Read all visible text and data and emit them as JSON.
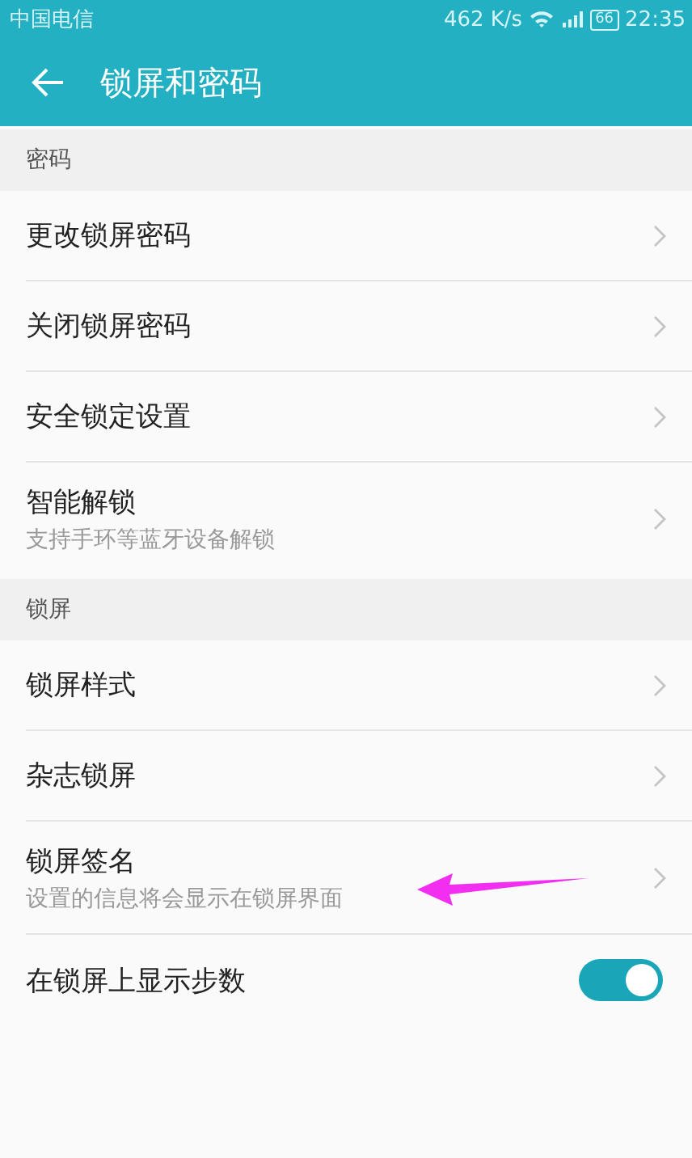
{
  "status_bar": {
    "carrier": "中国电信",
    "speed": "462 K/s",
    "battery": "66",
    "time": "22:35"
  },
  "header": {
    "title": "锁屏和密码"
  },
  "sections": [
    {
      "title": "密码",
      "items": [
        {
          "kind": "link",
          "label": "更改锁屏密码"
        },
        {
          "kind": "link",
          "label": "关闭锁屏密码"
        },
        {
          "kind": "link",
          "label": "安全锁定设置"
        },
        {
          "kind": "link",
          "label": "智能解锁",
          "subtitle": "支持手环等蓝牙设备解锁"
        }
      ]
    },
    {
      "title": "锁屏",
      "items": [
        {
          "kind": "link",
          "label": "锁屏样式"
        },
        {
          "kind": "link",
          "label": "杂志锁屏"
        },
        {
          "kind": "link",
          "label": "锁屏签名",
          "subtitle": "设置的信息将会显示在锁屏界面"
        },
        {
          "kind": "switch",
          "label": "在锁屏上显示步数",
          "on": true
        }
      ]
    }
  ]
}
